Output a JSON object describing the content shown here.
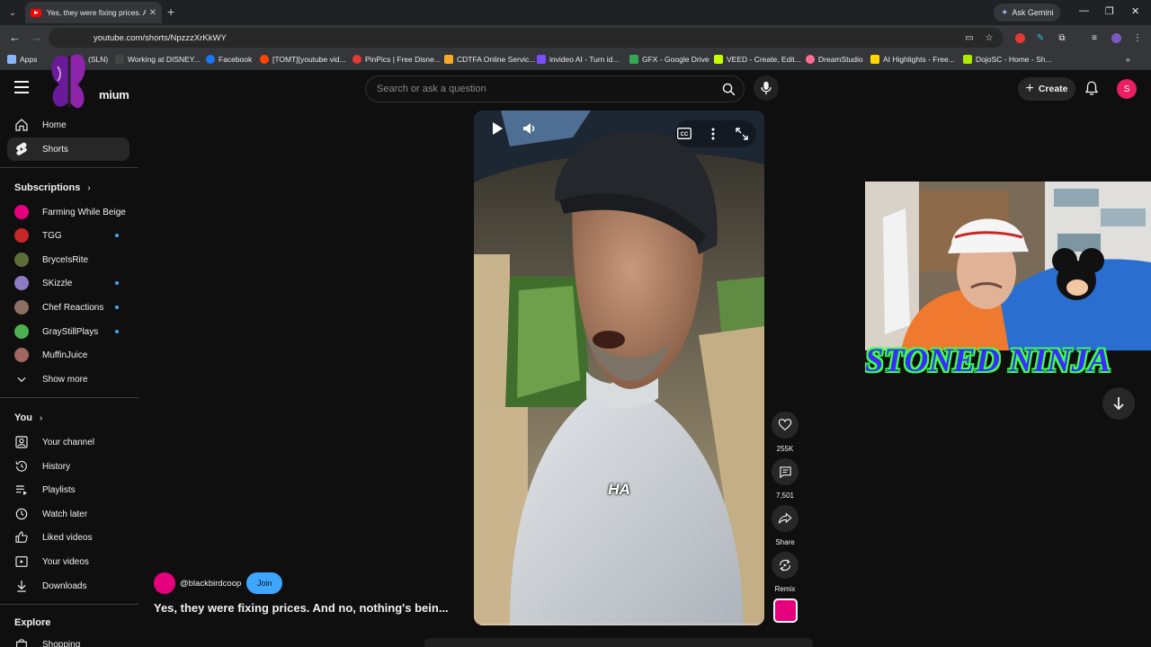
{
  "browser": {
    "tab_title": "Yes, they were fixing prices. And no, nothing's being done",
    "ask_gemini": "Ask Gemini",
    "url": "youtube.com/shorts/NpzzzXrKkWY",
    "bookmarks": [
      {
        "label": "Apps",
        "color": "#8ab4f8"
      },
      {
        "label": "(SLN)",
        "color": "#888888"
      },
      {
        "label": "Working at DISNEY...",
        "color": "#444444"
      },
      {
        "label": "Facebook",
        "color": "#1877f2"
      },
      {
        "label": "[TOMT][youtube vid...",
        "color": "#ff4500"
      },
      {
        "label": "PinPics | Free Disne...",
        "color": "#e53935"
      },
      {
        "label": "CDTFA Online Servic...",
        "color": "#f9a825"
      },
      {
        "label": "invideo AI - Turn id...",
        "color": "#7c4dff"
      },
      {
        "label": "GFX - Google Drive",
        "color": "#34a853"
      },
      {
        "label": "VEED - Create, Edit...",
        "color": "#c6ff00"
      },
      {
        "label": "DreamStudio",
        "color": "#ff6d91"
      },
      {
        "label": "AI Highlights - Free...",
        "color": "#ffd600"
      },
      {
        "label": "DojoSC - Home - Sh...",
        "color": "#aeea00"
      }
    ]
  },
  "header": {
    "brand_suffix": "mium",
    "search_placeholder": "Search or ask a question",
    "create_label": "Create",
    "avatar_initial": "S"
  },
  "sidebar": {
    "main": [
      {
        "label": "Home",
        "icon": "home-icon"
      },
      {
        "label": "Shorts",
        "icon": "shorts-icon",
        "active": true
      }
    ],
    "subscriptions_title": "Subscriptions",
    "subscriptions": [
      {
        "label": "Farming While Beige",
        "color": "#e6007e",
        "dot": false
      },
      {
        "label": "TGG",
        "color": "#c62828",
        "dot": true
      },
      {
        "label": "BryceIsRite",
        "color": "#5d6d3a",
        "dot": false
      },
      {
        "label": "SKizzle",
        "color": "#8e7cc3",
        "dot": true
      },
      {
        "label": "Chef Reactions",
        "color": "#8d6e63",
        "dot": true
      },
      {
        "label": "GrayStillPlays",
        "color": "#4caf50",
        "dot": true
      },
      {
        "label": "MuffinJuice",
        "color": "#a1665e",
        "dot": false
      }
    ],
    "show_more": "Show more",
    "you_title": "You",
    "you_items": [
      {
        "label": "Your channel",
        "icon": "user-icon"
      },
      {
        "label": "History",
        "icon": "history-icon"
      },
      {
        "label": "Playlists",
        "icon": "playlists-icon"
      },
      {
        "label": "Watch later",
        "icon": "clock-icon"
      },
      {
        "label": "Liked videos",
        "icon": "thumbs-up-icon"
      },
      {
        "label": "Your videos",
        "icon": "video-icon"
      },
      {
        "label": "Downloads",
        "icon": "download-icon"
      }
    ],
    "explore_title": "Explore",
    "explore_first": "Shopping"
  },
  "short": {
    "caption": "HA",
    "channel": "@blackbirdcoop",
    "join_label": "Join",
    "title": "Yes, they were fixing prices. And no, nothing's bein...",
    "progress_fraction": 0.02
  },
  "actions": {
    "likes": "255K",
    "comments": "7,501",
    "share": "Share",
    "remix": "Remix"
  },
  "overlay": {
    "text": "STONED NINJA"
  }
}
